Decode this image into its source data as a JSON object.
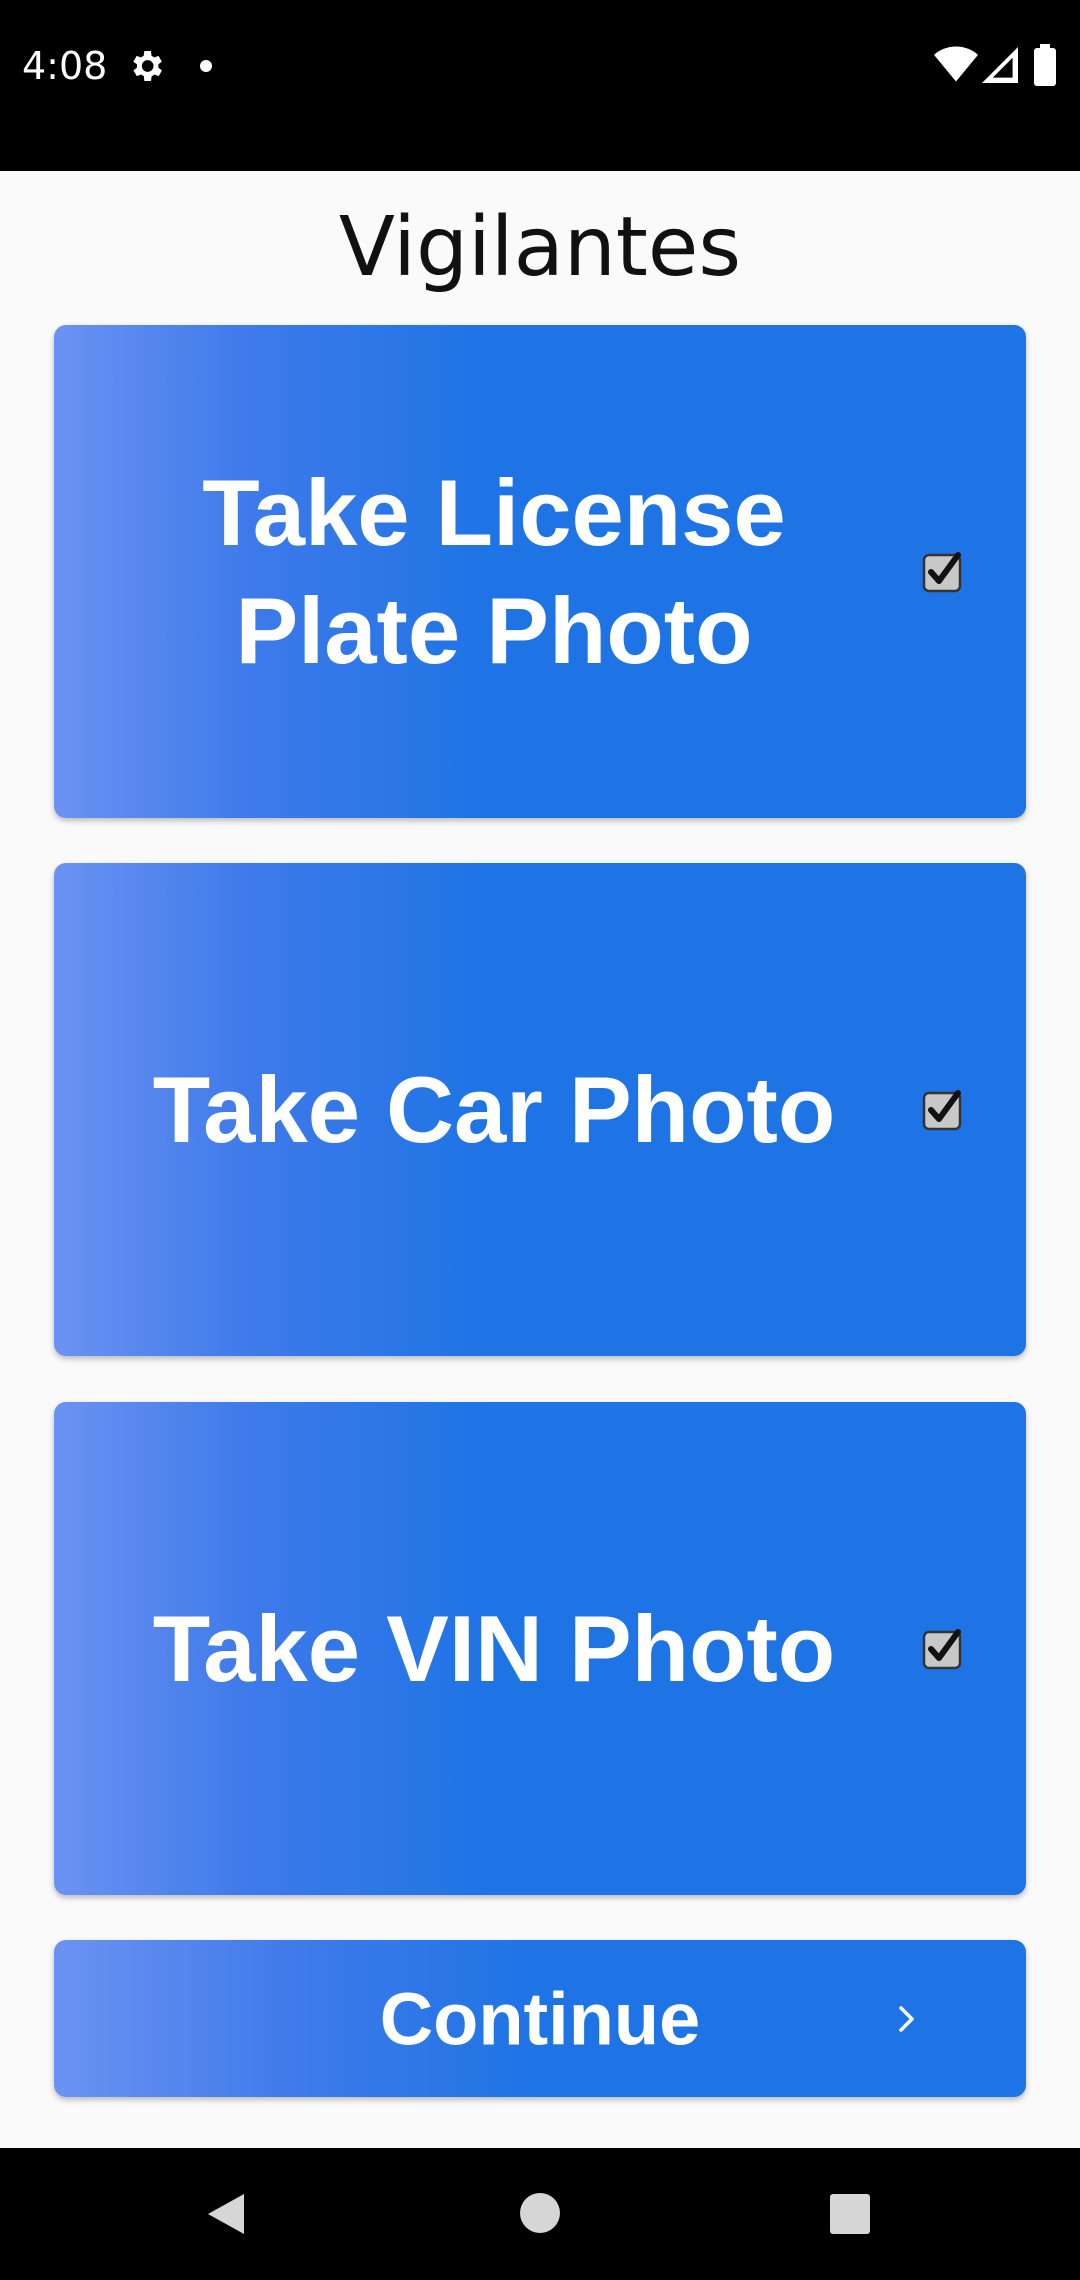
{
  "status_bar": {
    "time": "4:08",
    "icons": [
      "gear-icon",
      "notification-dot-icon",
      "wifi-icon",
      "signal-icon",
      "battery-icon"
    ]
  },
  "app": {
    "title": "Vigilantes"
  },
  "tasks": [
    {
      "label": "Take License Plate Photo",
      "checked": true
    },
    {
      "label": "Take Car Photo",
      "checked": true
    },
    {
      "label": "Take VIN Photo",
      "checked": true
    }
  ],
  "continue_button": {
    "label": "Continue",
    "icon": "chevron-right-icon"
  },
  "nav_bar": {
    "icons": [
      "back-icon",
      "home-icon",
      "recents-icon"
    ]
  },
  "colors": {
    "accent": "#1e74e5",
    "accent_light": "#6b93f2",
    "status_bar": "#000000",
    "background": "#fafafa"
  }
}
